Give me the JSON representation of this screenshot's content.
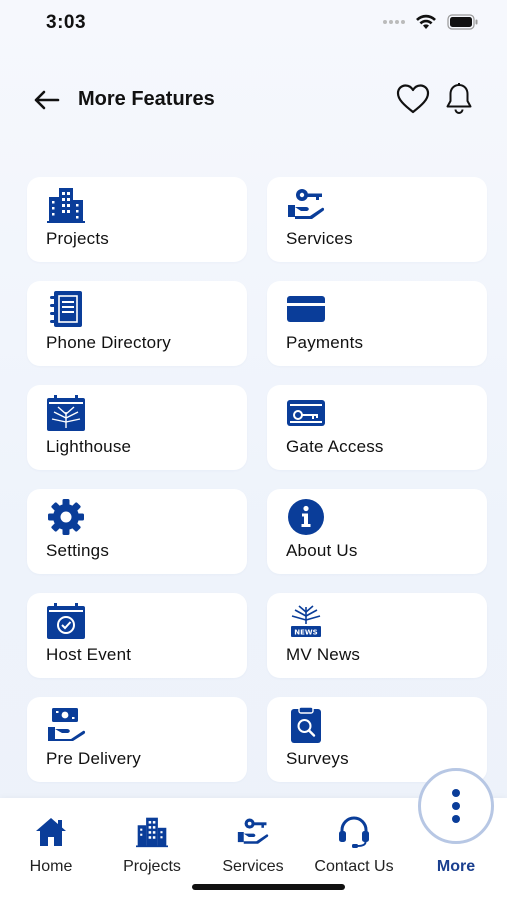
{
  "status": {
    "time": "3:03"
  },
  "header": {
    "title": "More Features"
  },
  "colors": {
    "accent": "#0a3d99",
    "active_nav": "#1a3f8f",
    "fab_ring": "#b7c7e4"
  },
  "features": [
    {
      "label": "Projects",
      "icon": "buildings-icon"
    },
    {
      "label": "Services",
      "icon": "key-hand-icon"
    },
    {
      "label": "Phone Directory",
      "icon": "notebook-icon"
    },
    {
      "label": "Payments",
      "icon": "credit-card-icon"
    },
    {
      "label": "Lighthouse",
      "icon": "lighthouse-calendar-icon"
    },
    {
      "label": "Gate Access",
      "icon": "access-card-icon"
    },
    {
      "label": "Settings",
      "icon": "gear-icon"
    },
    {
      "label": "About Us",
      "icon": "info-icon"
    },
    {
      "label": "Host Event",
      "icon": "event-calendar-icon"
    },
    {
      "label": "MV News",
      "icon": "news-icon"
    },
    {
      "label": "Pre Delivery",
      "icon": "money-hand-icon"
    },
    {
      "label": "Surveys",
      "icon": "clipboard-search-icon"
    }
  ],
  "nav": {
    "items": [
      {
        "label": "Home",
        "icon": "home-icon"
      },
      {
        "label": "Projects",
        "icon": "buildings-icon"
      },
      {
        "label": "Services",
        "icon": "key-hand-icon"
      },
      {
        "label": "Contact Us",
        "icon": "headset-icon"
      },
      {
        "label": "More",
        "icon": "more-vertical-icon",
        "active": true
      }
    ]
  }
}
